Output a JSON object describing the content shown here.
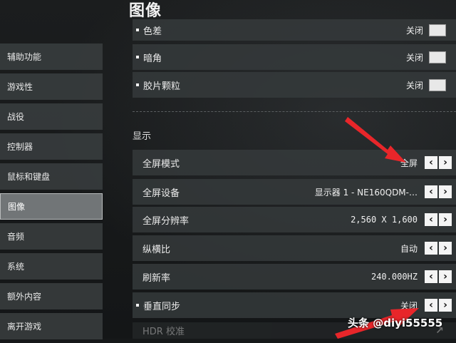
{
  "page": {
    "title": "图像"
  },
  "sidebar": {
    "items": [
      {
        "label": "辅助功能"
      },
      {
        "label": "游戏性"
      },
      {
        "label": "战役"
      },
      {
        "label": "控制器"
      },
      {
        "label": "鼠标和键盘"
      },
      {
        "label": "图像",
        "active": true
      },
      {
        "label": "音频"
      },
      {
        "label": "系统"
      },
      {
        "label": "额外内容"
      },
      {
        "label": "离开游戏"
      }
    ]
  },
  "graphics_rows": [
    {
      "label": "色差",
      "value": "关闭"
    },
    {
      "label": "暗角",
      "value": "关闭"
    },
    {
      "label": "胶片颗粒",
      "value": "关闭"
    }
  ],
  "display": {
    "section_label": "显示",
    "rows": [
      {
        "label": "全屏模式",
        "value": "全屏"
      },
      {
        "label": "全屏设备",
        "value": "显示器 1 - NE160QDM-…"
      },
      {
        "label": "全屏分辨率",
        "value": "2,560 X 1,600"
      },
      {
        "label": "纵横比",
        "value": "自动"
      },
      {
        "label": "刷新率",
        "value": "240.000HZ"
      },
      {
        "label": "垂直同步",
        "value": "关闭"
      },
      {
        "label": "HDR 校准",
        "value": ""
      }
    ]
  },
  "icons": {
    "prev": "‹",
    "next": "›",
    "external": "↗"
  },
  "watermark": "头条 @diyi55555",
  "colors": {
    "annotation": "#e8262a",
    "active_bg": "#76797b"
  }
}
